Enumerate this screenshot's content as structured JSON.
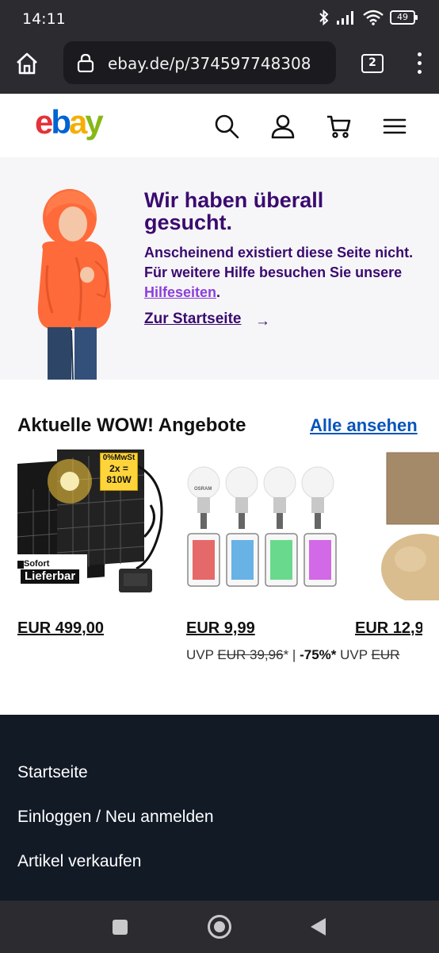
{
  "status_bar": {
    "time": "14:11",
    "battery": "49"
  },
  "browser": {
    "url": "ebay.de/p/374597748308",
    "tab_count": "2"
  },
  "header": {
    "logo": {
      "e": "e",
      "b": "b",
      "a": "a",
      "y": "y"
    }
  },
  "error": {
    "title": "Wir haben überall gesucht.",
    "message_part1": "Anscheinend existiert diese Seite nicht. Für weitere Hilfe besuchen Sie unsere ",
    "help_link": "Hilfeseiten",
    "message_part2": ".",
    "home_link": "Zur Startseite",
    "arrow": "→"
  },
  "deals": {
    "title": "Aktuelle WOW! Angebote",
    "see_all": "Alle ansehen",
    "items": [
      {
        "badge_vat": "0%MwSt",
        "badge_power_line1": "2x =",
        "badge_power_line2": "810W",
        "badge_sofort": "Sofort",
        "badge_lieferbar": "Lieferbar",
        "price": "EUR 499,00"
      },
      {
        "brand": "OSRAM",
        "price": "EUR 9,99",
        "uvp_label": "UVP",
        "uvp_price": "EUR 39,96",
        "uvp_star": "*",
        "sep": "|",
        "discount": "-75%*"
      },
      {
        "price": "EUR 12,9",
        "uvp_label": "UVP",
        "uvp_price": "EUR"
      }
    ]
  },
  "footer": {
    "items": [
      "Startseite",
      "Einloggen / Neu anmelden",
      "Artikel verkaufen"
    ]
  }
}
